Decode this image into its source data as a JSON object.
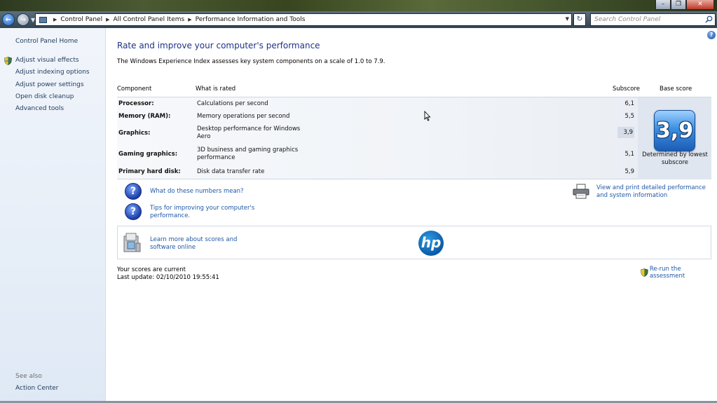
{
  "window": {
    "minimize_glyph": "–",
    "restore_glyph": "❐",
    "close_glyph": "✕"
  },
  "nav": {
    "back_glyph": "←",
    "forward_glyph": "→",
    "breadcrumbs": [
      "Control Panel",
      "All Control Panel Items",
      "Performance Information and Tools"
    ],
    "refresh_glyph": "↻",
    "search_placeholder": "Search Control Panel"
  },
  "sidebar": {
    "home": "Control Panel Home",
    "items": [
      {
        "label": "Adjust visual effects",
        "icon": "shield-icon"
      },
      {
        "label": "Adjust indexing options"
      },
      {
        "label": "Adjust power settings"
      },
      {
        "label": "Open disk cleanup"
      },
      {
        "label": "Advanced tools"
      }
    ],
    "see_also_label": "See also",
    "see_also_items": [
      "Action Center"
    ]
  },
  "main": {
    "title": "Rate and improve your computer's performance",
    "intro": "The Windows Experience Index assesses key system components on a scale of 1.0 to 7.9.",
    "table": {
      "headers": {
        "component": "Component",
        "rated": "What is rated",
        "subscore": "Subscore",
        "base": "Base score"
      },
      "rows": [
        {
          "component": "Processor:",
          "rated": "Calculations per second",
          "subscore": "6,1"
        },
        {
          "component": "Memory (RAM):",
          "rated": "Memory operations per second",
          "subscore": "5,5"
        },
        {
          "component": "Graphics:",
          "rated": "Desktop performance for Windows Aero",
          "subscore": "3,9"
        },
        {
          "component": "Gaming graphics:",
          "rated": "3D business and gaming graphics performance",
          "subscore": "5,1"
        },
        {
          "component": "Primary hard disk:",
          "rated": "Disk data transfer rate",
          "subscore": "5,9"
        }
      ],
      "base_score": "3,9",
      "base_caption": "Determined by lowest subscore"
    },
    "links": {
      "numbers": "What do these numbers mean?",
      "tips": "Tips for improving your computer's performance.",
      "print": "View and print detailed performance and system information"
    },
    "oem": {
      "learn_more": "Learn more about scores and software online",
      "logo_text": "hp"
    },
    "status": {
      "current": "Your scores are current",
      "last_update": "Last update: 02/10/2010 19:55:41"
    },
    "rerun": "Re-run the assessment"
  },
  "colors": {
    "link": "#1e58a8",
    "heading": "#1e3287",
    "badge": "#3b8fe0"
  }
}
